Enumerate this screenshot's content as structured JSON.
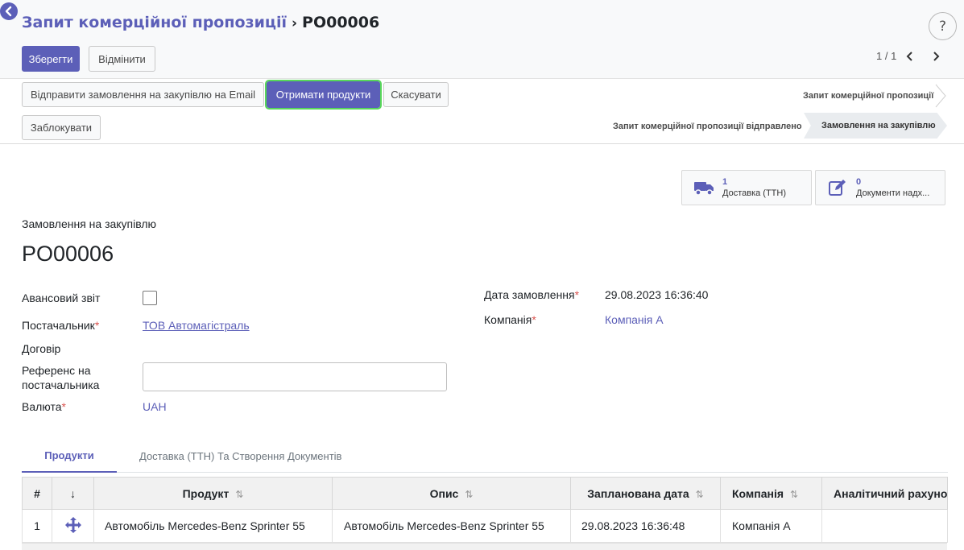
{
  "header": {
    "breadcrumb_parent": "Запит комерційної пропозиції",
    "breadcrumb_current": "PO00006",
    "help_label": "?"
  },
  "toolbar": {
    "save_label": "Зберегти",
    "discard_label": "Відмінити",
    "pager_value": "1 / 1"
  },
  "actions": {
    "send_email_label": "Відправити замовлення на закупівлю на Email",
    "receive_products_label": "Отримати продукти",
    "cancel_label": "Скасувати",
    "lock_label": "Заблокувати"
  },
  "statusbar": {
    "stage_rfq": "Запит комерційної пропозиції",
    "stage_rfq_sent": "Запит комерційної пропозиції відправлено",
    "stage_purchase_order": "Замовлення на закупівлю",
    "active_stage": "Замовлення на закупівлю"
  },
  "smart_buttons": {
    "delivery_count": "1",
    "delivery_label": "Доставка (ТТН)",
    "documents_count": "0",
    "documents_label": "Документи надх..."
  },
  "form": {
    "record_type": "Замовлення на закупівлю",
    "record_name": "PO00006",
    "advance_report_label": "Авансовий звіт",
    "advance_report_checked": false,
    "vendor_label": "Постачальник",
    "vendor_value": "ТОВ Автомагістраль",
    "contract_label": "Договір",
    "vendor_ref_label_1": "Референс на",
    "vendor_ref_label_2": "постачальника",
    "vendor_ref_value": "",
    "currency_label": "Валюта",
    "currency_value": "UAH",
    "order_date_label": "Дата замовлення",
    "order_date_value": "29.08.2023 16:36:40",
    "company_label": "Компанія",
    "company_value": "Компанія А",
    "required_mark": "*"
  },
  "tabs": {
    "products": "Продукти",
    "delivery": "Доставка (ТТН) Та Створення Документів"
  },
  "lines_table": {
    "col_num": "#",
    "col_handle": "↓",
    "col_product": "Продукт",
    "col_description": "Опис",
    "col_planned_date": "Запланована дата",
    "col_company": "Компанія",
    "col_analytic": "Аналітичний рахунок",
    "rows": [
      {
        "num": "1",
        "product": "Автомобіль Mercedes-Benz Sprinter 55",
        "description": "Автомобіль Mercedes-Benz Sprinter 55",
        "planned_date": "29.08.2023 16:36:48",
        "company": "Компанія А",
        "analytic": ""
      }
    ]
  },
  "colors": {
    "primary": "#5c5fb8",
    "highlight_border": "#57d65a",
    "required": "#d9534f"
  }
}
